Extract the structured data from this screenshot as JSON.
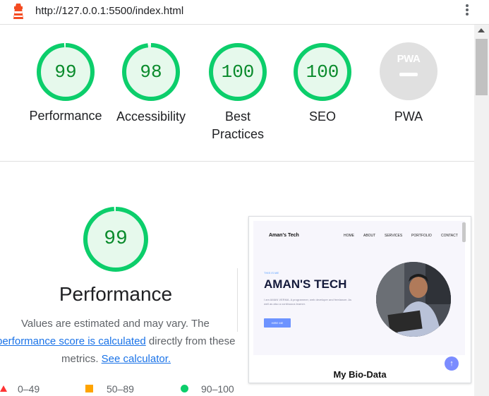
{
  "browser": {
    "url": "http://127.0.0.1:5500/index.html",
    "logo_icon": "lighthouse-icon",
    "menu_icon": "kebab-menu-icon"
  },
  "gauges": [
    {
      "key": "performance",
      "score": "99",
      "label": "Performance",
      "fraction": 0.99
    },
    {
      "key": "accessibility",
      "score": "98",
      "label": "Accessibility",
      "fraction": 0.98
    },
    {
      "key": "best_practices",
      "score": "100",
      "label_line1": "Best",
      "label_line2": "Practices",
      "fraction": 1.0
    },
    {
      "key": "seo",
      "score": "100",
      "label": "SEO",
      "fraction": 1.0
    }
  ],
  "pwa": {
    "badge": "PWA",
    "label": "PWA"
  },
  "performance_section": {
    "score": "99",
    "fraction": 0.99,
    "title": "Performance",
    "desc_line1": "Values are estimated and may vary. The",
    "desc_link1": "performance score is calculated",
    "desc_line2_rest": " directly from these",
    "desc_line3_start": "metrics. ",
    "desc_link2": "See calculator.",
    "legend": [
      {
        "range": "0–49",
        "color": "#ff3333"
      },
      {
        "range": "50–89",
        "color": "#ffa400"
      },
      {
        "range": "90–100",
        "color": "#0cce6b"
      }
    ]
  },
  "colors": {
    "pass": "#0cce6b",
    "pass_text": "#0a8b2c",
    "pass_bg": "#e6f9ec"
  },
  "preview": {
    "brand": "Aman's Tech",
    "nav": [
      "HOME",
      "ABOUT",
      "SERVICES",
      "PORTFOLIO",
      "CONTACT"
    ],
    "tag": "THIS IS ME",
    "title": "AMAN'S TECH",
    "subtitle": "I am AMAN VERMA. A programmer, web developer and freelancer. As well as also a continuous learner.",
    "button": "HIRE ME",
    "bio_heading": "My Bio-Data",
    "up_icon": "arrow-up-icon"
  }
}
